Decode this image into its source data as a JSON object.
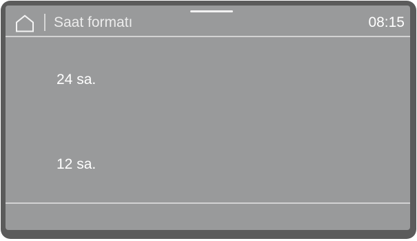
{
  "header": {
    "home_icon": "home-icon",
    "title": "Saat formatı",
    "time": "08:15"
  },
  "options": [
    {
      "label": "24 sa."
    },
    {
      "label": "12 sa."
    }
  ],
  "colors": {
    "bezel": "#5b5b5b",
    "screen": "#999a9b",
    "text": "#ffffff",
    "divider": "#d3d3d3"
  }
}
